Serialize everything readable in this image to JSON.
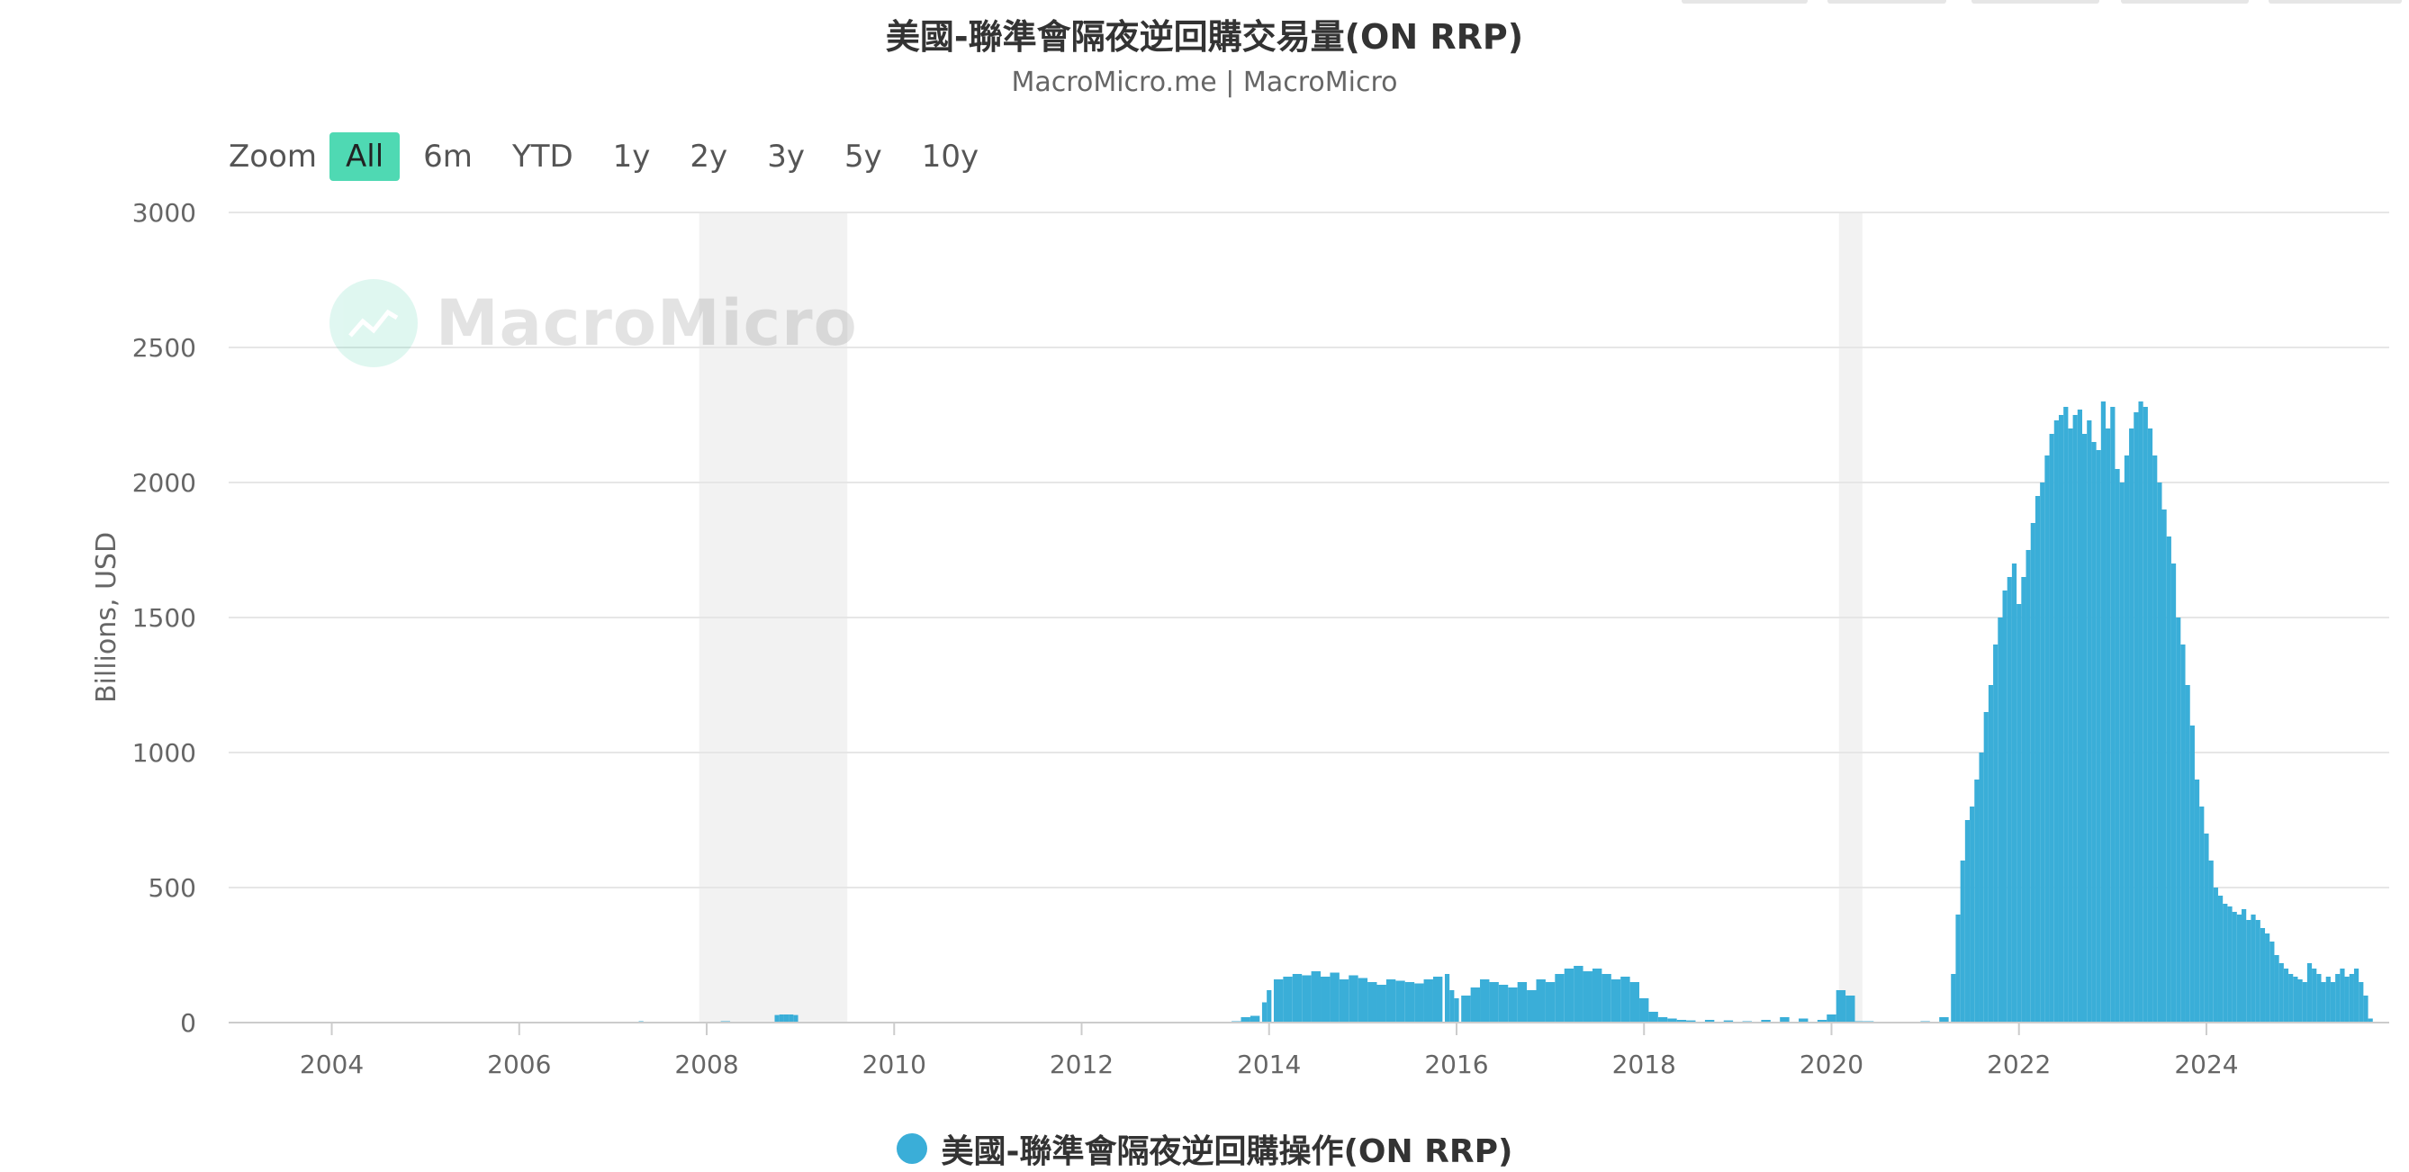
{
  "header": {
    "title": "美國-聯準會隔夜逆回購交易量(ON RRP)",
    "subtitle": "MacroMicro.me | MacroMicro"
  },
  "zoom": {
    "label": "Zoom",
    "options": [
      "All",
      "6m",
      "YTD",
      "1y",
      "2y",
      "3y",
      "5y",
      "10y"
    ],
    "selected": "All"
  },
  "watermark": {
    "text": "MacroMicro",
    "icon": "chart-line-logo-icon"
  },
  "legend": {
    "label": "美國-聯準會隔夜逆回購操作(ON RRP)"
  },
  "colors": {
    "series": "#3aaed8",
    "accent": "#4fd9b3",
    "recession": "#f2f2f2",
    "grid": "#e6e6e6"
  },
  "chart_data": {
    "type": "bar",
    "ylabel": "Billions, USD",
    "ylim": [
      0,
      3000
    ],
    "yticks": [
      0,
      500,
      1000,
      1500,
      2000,
      2500,
      3000
    ],
    "xlim": [
      2002.9,
      2025.95
    ],
    "xticks": [
      "2004",
      "2006",
      "2008",
      "2010",
      "2012",
      "2014",
      "2016",
      "2018",
      "2020",
      "2022",
      "2024"
    ],
    "grid": true,
    "legend_position": "bottom-center",
    "shaded_periods": [
      [
        2007.92,
        2009.5
      ],
      [
        2020.08,
        2020.33
      ]
    ],
    "series": [
      {
        "name": "美國-聯準會隔夜逆回購操作(ON RRP)",
        "x": [
          2007.3,
          2008.2,
          2008.75,
          2008.8,
          2008.85,
          2008.9,
          2008.95,
          2013.65,
          2013.75,
          2013.85,
          2013.95,
          2014.0,
          2014.1,
          2014.2,
          2014.3,
          2014.4,
          2014.5,
          2014.6,
          2014.7,
          2014.8,
          2014.9,
          2015.0,
          2015.1,
          2015.2,
          2015.3,
          2015.4,
          2015.5,
          2015.6,
          2015.7,
          2015.8,
          2015.9,
          2015.95,
          2016.0,
          2016.1,
          2016.2,
          2016.3,
          2016.4,
          2016.5,
          2016.6,
          2016.7,
          2016.8,
          2016.9,
          2017.0,
          2017.1,
          2017.2,
          2017.3,
          2017.4,
          2017.5,
          2017.6,
          2017.7,
          2017.8,
          2017.9,
          2018.0,
          2018.1,
          2018.2,
          2018.3,
          2018.4,
          2018.5,
          2018.7,
          2018.9,
          2019.1,
          2019.3,
          2019.5,
          2019.7,
          2019.9,
          2020.0,
          2020.1,
          2020.2,
          2020.3,
          2020.4,
          2021.0,
          2021.2,
          2021.3,
          2021.35,
          2021.4,
          2021.45,
          2021.5,
          2021.55,
          2021.6,
          2021.65,
          2021.7,
          2021.75,
          2021.8,
          2021.85,
          2021.9,
          2021.95,
          2022.0,
          2022.05,
          2022.1,
          2022.15,
          2022.2,
          2022.25,
          2022.3,
          2022.35,
          2022.4,
          2022.45,
          2022.5,
          2022.55,
          2022.6,
          2022.65,
          2022.7,
          2022.75,
          2022.8,
          2022.85,
          2022.9,
          2022.95,
          2023.0,
          2023.05,
          2023.1,
          2023.15,
          2023.2,
          2023.25,
          2023.3,
          2023.35,
          2023.4,
          2023.45,
          2023.5,
          2023.55,
          2023.6,
          2023.65,
          2023.7,
          2023.75,
          2023.8,
          2023.85,
          2023.9,
          2023.95,
          2024.0,
          2024.05,
          2024.1,
          2024.15,
          2024.2,
          2024.25,
          2024.3,
          2024.35,
          2024.4,
          2024.45,
          2024.5,
          2024.55,
          2024.6,
          2024.65,
          2024.7,
          2024.75,
          2024.8,
          2024.85,
          2024.9,
          2024.95,
          2025.0,
          2025.05,
          2025.1,
          2025.15,
          2025.2,
          2025.25,
          2025.3,
          2025.35,
          2025.4,
          2025.45,
          2025.5,
          2025.55,
          2025.6,
          2025.65,
          2025.7,
          2025.75
        ],
        "values": [
          5,
          5,
          28,
          30,
          30,
          30,
          28,
          5,
          20,
          25,
          75,
          120,
          160,
          170,
          180,
          175,
          190,
          170,
          185,
          160,
          175,
          165,
          150,
          140,
          160,
          155,
          150,
          145,
          160,
          170,
          180,
          120,
          90,
          100,
          130,
          160,
          150,
          140,
          130,
          150,
          120,
          160,
          150,
          180,
          200,
          210,
          190,
          200,
          180,
          160,
          170,
          150,
          90,
          40,
          20,
          15,
          10,
          8,
          10,
          8,
          5,
          10,
          20,
          15,
          10,
          30,
          120,
          100,
          5,
          5,
          5,
          20,
          180,
          400,
          600,
          750,
          800,
          900,
          1000,
          1150,
          1250,
          1400,
          1500,
          1600,
          1650,
          1700,
          1550,
          1650,
          1750,
          1850,
          1950,
          2000,
          2100,
          2180,
          2230,
          2250,
          2280,
          2200,
          2250,
          2270,
          2180,
          2230,
          2150,
          2120,
          2300,
          2200,
          2280,
          2050,
          2000,
          2100,
          2200,
          2260,
          2300,
          2280,
          2200,
          2100,
          2000,
          1900,
          1800,
          1700,
          1500,
          1400,
          1250,
          1100,
          900,
          800,
          700,
          600,
          500,
          470,
          440,
          430,
          410,
          400,
          420,
          380,
          400,
          380,
          350,
          330,
          300,
          250,
          220,
          200,
          180,
          170,
          160,
          150,
          220,
          200,
          180,
          150,
          170,
          150,
          180,
          200,
          170,
          180,
          200,
          150,
          100,
          15
        ]
      }
    ]
  }
}
